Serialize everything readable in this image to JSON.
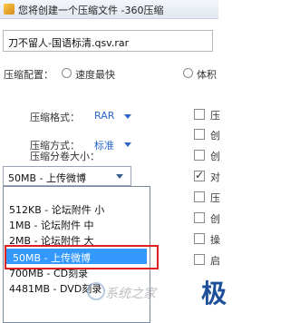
{
  "window": {
    "title": "您将创建一个压缩文件 -360压缩"
  },
  "filename": "刀不留人-国语标清.qsv.rar",
  "config": {
    "label": "压缩配置：",
    "option_speed": "速度最快",
    "option_size_partial": "体积"
  },
  "format": {
    "label": "压缩格式：",
    "value": "RAR"
  },
  "method": {
    "label": "压缩方式：",
    "value": "标准"
  },
  "split": {
    "label": "压缩分卷大小：",
    "selected": "50MB - 上传微博"
  },
  "dropdown_items": [
    "512KB - 论坛附件 小",
    "1MB - 论坛附件 中",
    "2MB - 论坛附件 大",
    "50MB - 上传微博",
    "700MB - CD刻录",
    "4481MB - DVD刻录"
  ],
  "right_options": [
    "压",
    "创",
    "创",
    "对",
    "压",
    "创",
    "操",
    "启"
  ],
  "right_checked_index": 3,
  "side_glyph": "极",
  "watermark": "系统之家",
  "colors": {
    "accent": "#2c67c8",
    "selection": "#3399ff",
    "highlight_box": "#e02020"
  }
}
